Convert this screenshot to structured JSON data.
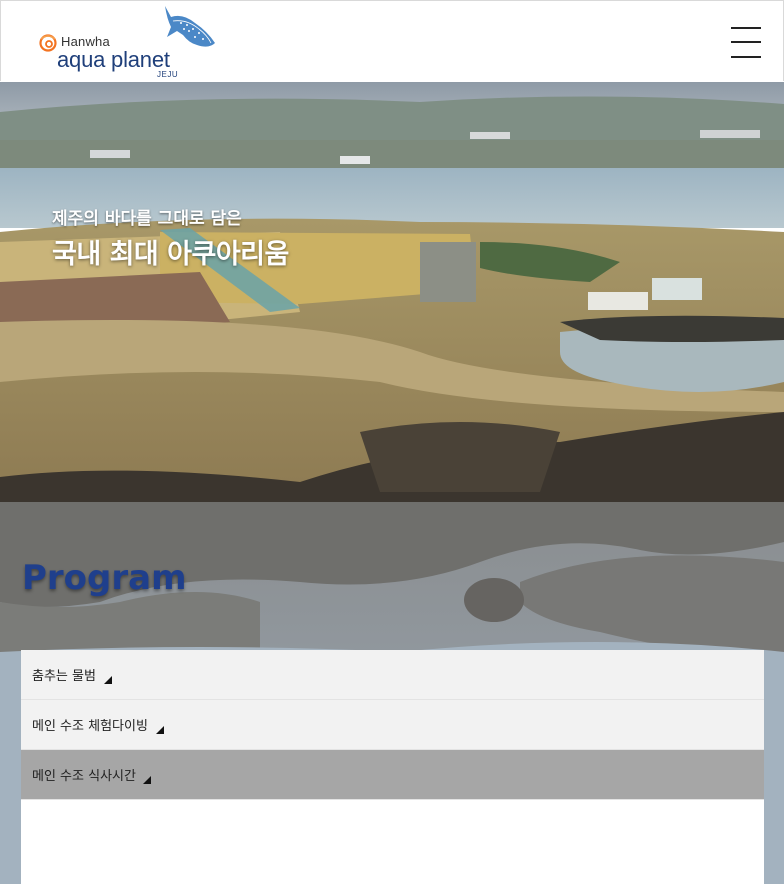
{
  "header": {
    "brand_prefix": "Hanwha",
    "brand_name": "aqua planet",
    "brand_location": "JEJU",
    "menu_icon": "hamburger-menu-icon"
  },
  "hero": {
    "subtitle": "제주의 바다를 그대로 담은",
    "title": "국내 최대 아쿠아리움"
  },
  "program": {
    "title": "Program",
    "items": [
      {
        "label": "춤추는 물범",
        "active": false
      },
      {
        "label": "메인 수조 체험다이빙",
        "active": false
      },
      {
        "label": "메인 수조 식사시간",
        "active": true
      }
    ]
  },
  "colors": {
    "brand_navy": "#1f3f7a",
    "program_title": "#1f3f8c",
    "hanwha_orange": "#f37321",
    "accordion_bg": "#f2f2f2",
    "accordion_active_bg": "#a6a6a6"
  }
}
